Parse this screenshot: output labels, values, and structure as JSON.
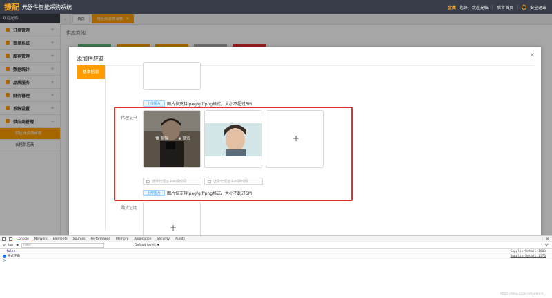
{
  "header": {
    "brand": "捷配",
    "system_name": "元器件智能采购系统",
    "user": "金鹰",
    "greeting": "您好，欢迎光临",
    "admin_home": "后台首页",
    "logout": "安全退出"
  },
  "sidebar": {
    "welcome": "欢迎光临!",
    "items": [
      {
        "label": "订单管理",
        "icon": "order-icon"
      },
      {
        "label": "审单系统",
        "icon": "audit-icon"
      },
      {
        "label": "库存管理",
        "icon": "stock-icon"
      },
      {
        "label": "数据统计",
        "icon": "stats-icon"
      },
      {
        "label": "品质服务",
        "icon": "quality-icon"
      },
      {
        "label": "财务管理",
        "icon": "finance-icon"
      },
      {
        "label": "系统设置",
        "icon": "settings-icon"
      },
      {
        "label": "供应商管理",
        "icon": "supplier-icon"
      }
    ],
    "sub_items": [
      "供应商资质审核",
      "合格供应商"
    ]
  },
  "tabs": {
    "home": "首页",
    "active": "供应商资质审核"
  },
  "page": {
    "title": "供应商池"
  },
  "modal": {
    "title": "添加供应商",
    "nav_tab": "基本信息",
    "upload_btn": "上传图片",
    "upload_tip": "图片仅支持jpeg/gif/png格式，大小不超过5M",
    "agent_cert_label": "代理证书",
    "delete_label": "删除",
    "preview_label": "预览",
    "date_placeholder_1": "选择代理证书到期时间",
    "date_placeholder_2": "选择代理证书到期时间",
    "purchase_cert_label": "购货证明"
  },
  "devtools": {
    "tabs": [
      "Console",
      "Network",
      "Elements",
      "Sources",
      "Performance",
      "Memory",
      "Application",
      "Security",
      "Audits"
    ],
    "context": "top",
    "filter_placeholder": "Filter",
    "levels": "Default levels ▼",
    "log_false": "false",
    "log_info": "格式正确",
    "src1": "SupplierDetail:1603",
    "src2": "SupplierDetail:1576",
    "prompt": ">"
  },
  "watermark": "https://blog.csdn.net/weixin_..."
}
